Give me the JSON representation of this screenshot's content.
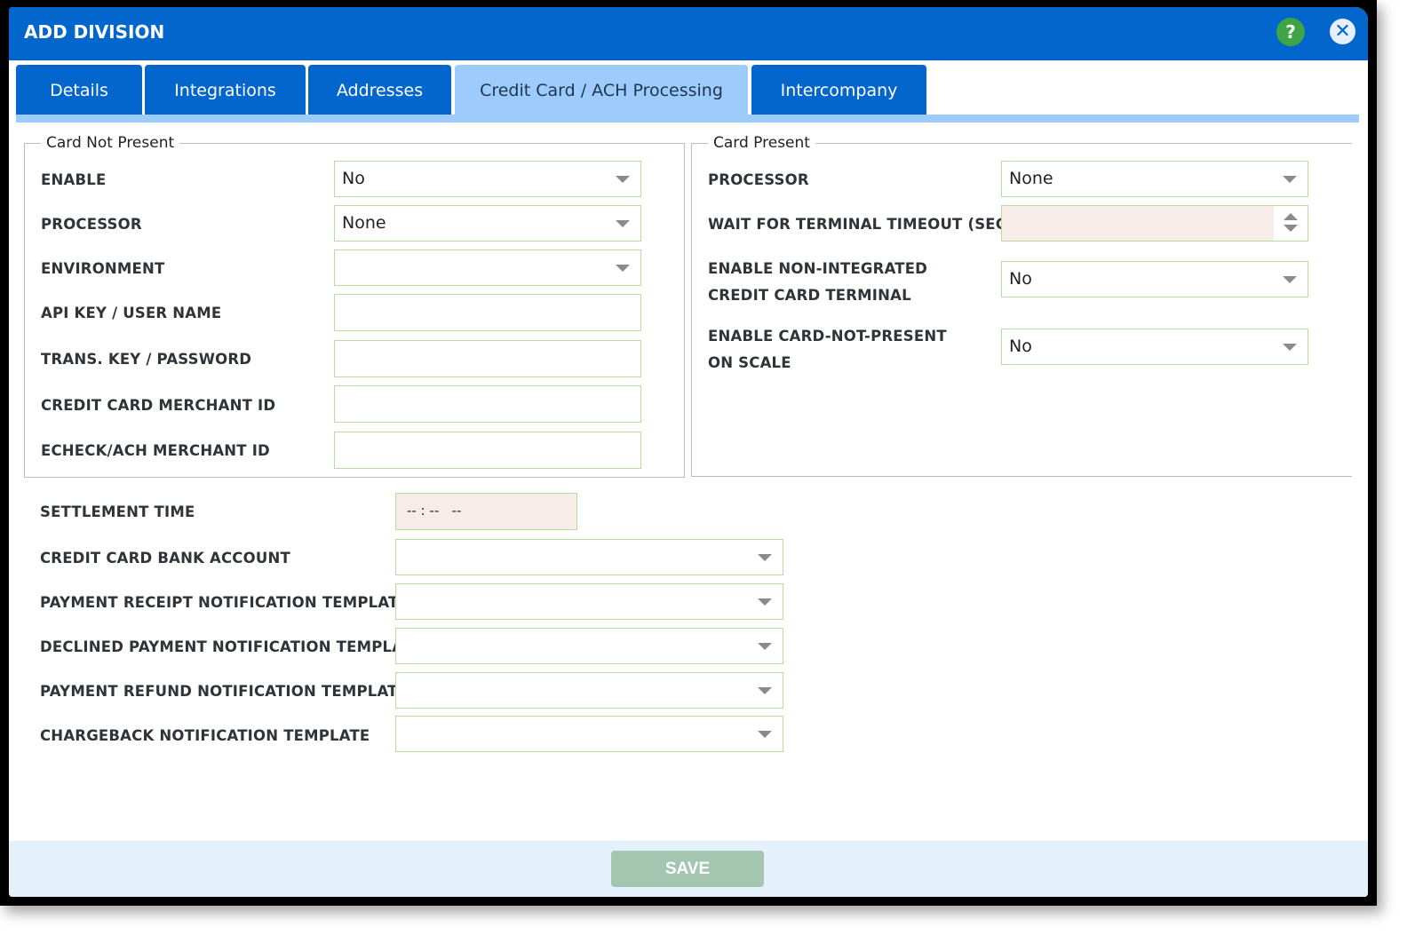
{
  "dialog": {
    "title": "ADD DIVISION",
    "help_label": "?",
    "close_label": "✕",
    "save_label": "SAVE"
  },
  "tabs": [
    {
      "label": "Details"
    },
    {
      "label": "Integrations"
    },
    {
      "label": "Addresses"
    },
    {
      "label": "Credit Card / ACH Processing",
      "active": true
    },
    {
      "label": "Intercompany"
    }
  ],
  "card_not_present": {
    "legend": "Card Not Present",
    "fields": [
      {
        "label": "ENABLE",
        "value": "No"
      },
      {
        "label": "PROCESSOR",
        "value": "None"
      },
      {
        "label": "ENVIRONMENT",
        "value": ""
      },
      {
        "label": "API KEY / USER NAME",
        "value": ""
      },
      {
        "label": "TRANS. KEY / PASSWORD",
        "value": ""
      },
      {
        "label": "CREDIT CARD MERCHANT ID",
        "value": ""
      },
      {
        "label": "ECHECK/ACH MERCHANT ID",
        "value": ""
      }
    ]
  },
  "card_present": {
    "legend": "Card Present",
    "fields": [
      {
        "label": "PROCESSOR",
        "value": "None"
      },
      {
        "label": "WAIT FOR TERMINAL TIMEOUT (SEC)",
        "value": ""
      },
      {
        "label": "ENABLE NON-INTEGRATED CREDIT CARD TERMINAL",
        "value": "No"
      },
      {
        "label": "ENABLE CARD-NOT-PRESENT ON SCALE",
        "value": "No"
      }
    ]
  },
  "general": {
    "fields": [
      {
        "label": "SETTLEMENT TIME",
        "value": "-- : --   --"
      },
      {
        "label": "CREDIT CARD BANK ACCOUNT",
        "value": ""
      },
      {
        "label": "PAYMENT RECEIPT NOTIFICATION TEMPLATE",
        "value": ""
      },
      {
        "label": "DECLINED PAYMENT NOTIFICATION TEMPLATE",
        "value": ""
      },
      {
        "label": "PAYMENT REFUND NOTIFICATION TEMPLATE",
        "value": ""
      },
      {
        "label": "CHARGEBACK NOTIFICATION TEMPLATE",
        "value": ""
      }
    ]
  }
}
